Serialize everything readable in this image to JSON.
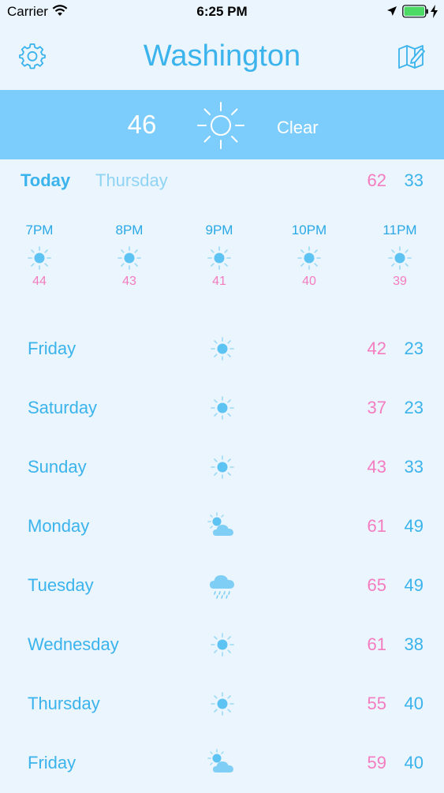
{
  "status_bar": {
    "carrier": "Carrier",
    "time": "6:25 PM"
  },
  "header": {
    "city": "Washington",
    "settings_icon": "gear-icon",
    "map_icon": "map-edit-icon"
  },
  "current": {
    "temp": "46",
    "condition": "Clear",
    "icon": "sun-icon"
  },
  "today": {
    "label": "Today",
    "day": "Thursday",
    "high": "62",
    "low": "33"
  },
  "hourly": [
    {
      "time": "7PM",
      "temp": "44",
      "icon": "sun-icon"
    },
    {
      "time": "8PM",
      "temp": "43",
      "icon": "sun-icon"
    },
    {
      "time": "9PM",
      "temp": "41",
      "icon": "sun-icon"
    },
    {
      "time": "10PM",
      "temp": "40",
      "icon": "sun-icon"
    },
    {
      "time": "11PM",
      "temp": "39",
      "icon": "sun-icon"
    }
  ],
  "daily": [
    {
      "day": "Friday",
      "icon": "sun",
      "high": "42",
      "low": "23"
    },
    {
      "day": "Saturday",
      "icon": "sun",
      "high": "37",
      "low": "23"
    },
    {
      "day": "Sunday",
      "icon": "sun",
      "high": "43",
      "low": "33"
    },
    {
      "day": "Monday",
      "icon": "partly-cloudy",
      "high": "61",
      "low": "49"
    },
    {
      "day": "Tuesday",
      "icon": "rain",
      "high": "65",
      "low": "49"
    },
    {
      "day": "Wednesday",
      "icon": "sun",
      "high": "61",
      "low": "38"
    },
    {
      "day": "Thursday",
      "icon": "sun",
      "high": "55",
      "low": "40"
    },
    {
      "day": "Friday",
      "icon": "partly-cloudy",
      "high": "59",
      "low": "40"
    }
  ],
  "colors": {
    "background": "#eaf5fd",
    "accent": "#3bb3ec",
    "banner": "#7dcdfc",
    "high_temp": "#f47cc0"
  }
}
